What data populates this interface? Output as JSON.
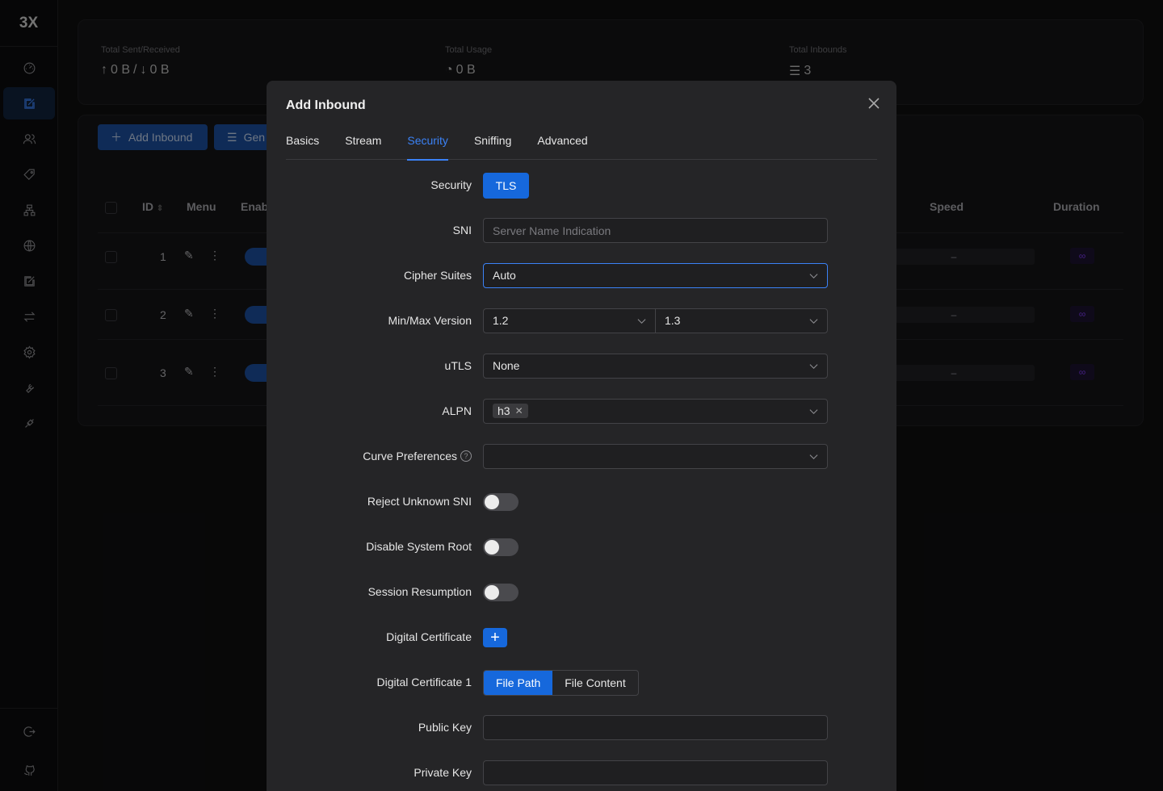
{
  "app": {
    "logo": "3X"
  },
  "sidebar": {
    "items": [
      {
        "icon": "dashboard-icon"
      },
      {
        "icon": "inbounds-icon",
        "active": true
      },
      {
        "icon": "users-icon"
      },
      {
        "icon": "tag-icon"
      },
      {
        "icon": "network-icon"
      },
      {
        "icon": "globe-icon"
      },
      {
        "icon": "edit-icon"
      },
      {
        "icon": "swap-icon"
      },
      {
        "icon": "settings-icon"
      },
      {
        "icon": "tools-icon"
      },
      {
        "icon": "api-icon"
      }
    ],
    "bottom": [
      {
        "icon": "logout-icon"
      },
      {
        "icon": "github-icon"
      }
    ]
  },
  "stats": {
    "sent_received_label": "Total Sent/Received",
    "sent": "0 B",
    "sep": "/",
    "received": "0 B",
    "usage_label": "Total Usage",
    "usage": "0 B",
    "inbounds_label": "Total Inbounds",
    "inbounds": "3"
  },
  "toolbar": {
    "add_inbound": "Add Inbound",
    "general": "Gen"
  },
  "table": {
    "headers": {
      "id": "ID",
      "menu": "Menu",
      "enable": "Enab",
      "speed": "Speed",
      "duration": "Duration"
    },
    "rows": [
      {
        "id": "1",
        "speed": "–",
        "duration": "∞"
      },
      {
        "id": "2",
        "speed": "–",
        "duration": "∞"
      },
      {
        "id": "3",
        "speed": "–",
        "duration": "∞"
      }
    ]
  },
  "modal": {
    "title": "Add Inbound",
    "tabs": [
      "Basics",
      "Stream",
      "Security",
      "Sniffing",
      "Advanced"
    ],
    "active_tab": "Security",
    "fields": {
      "security": {
        "label": "Security",
        "value": "TLS"
      },
      "sni": {
        "label": "SNI",
        "placeholder": "Server Name Indication",
        "value": ""
      },
      "cipher": {
        "label": "Cipher Suites",
        "value": "Auto"
      },
      "version": {
        "label": "Min/Max Version",
        "min": "1.2",
        "max": "1.3"
      },
      "utls": {
        "label": "uTLS",
        "value": "None"
      },
      "alpn": {
        "label": "ALPN",
        "tags": [
          "h3"
        ]
      },
      "curve": {
        "label": "Curve Preferences",
        "value": ""
      },
      "reject_sni": {
        "label": "Reject Unknown SNI",
        "on": false
      },
      "disable_root": {
        "label": "Disable System Root",
        "on": false
      },
      "session_resumption": {
        "label": "Session Resumption",
        "on": false
      },
      "digital_cert": {
        "label": "Digital Certificate",
        "add": "+"
      },
      "digital_cert_1": {
        "label": "Digital Certificate 1",
        "options": [
          "File Path",
          "File Content"
        ],
        "selected": "File Path"
      },
      "public_key": {
        "label": "Public Key",
        "value": ""
      },
      "private_key": {
        "label": "Private Key",
        "value": ""
      }
    }
  },
  "colors": {
    "accent": "#1668dc",
    "active_tab": "#3b82f6",
    "modal_bg": "#252527",
    "page_bg": "#0f0f10"
  }
}
